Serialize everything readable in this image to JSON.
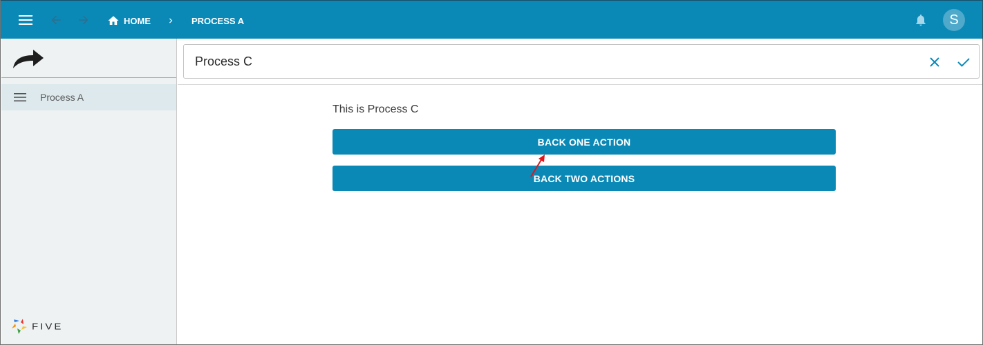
{
  "header": {
    "menu_icon": "hamburger-menu-icon",
    "back_icon": "arrow-back-icon",
    "forward_icon": "arrow-forward-icon",
    "breadcrumb": {
      "home_icon": "home-icon",
      "home_label": "HOME",
      "separator_icon": "chevron-right-icon",
      "current_label": "PROCESS A"
    },
    "notifications_icon": "bell-icon",
    "avatar_initial": "S"
  },
  "sidebar": {
    "top_icon": "redo-arrow-icon",
    "items": [
      {
        "icon": "list-menu-icon",
        "label": "Process A",
        "selected": true
      }
    ],
    "logo_text": "FIVE"
  },
  "main": {
    "title": "Process C",
    "cancel_icon": "close-icon",
    "confirm_icon": "check-icon",
    "description": "This is Process C",
    "buttons": [
      {
        "label": "BACK ONE ACTION"
      },
      {
        "label": "BACK TWO ACTIONS"
      }
    ]
  },
  "colors": {
    "primary": "#0b89b6",
    "sidebar_bg": "#eef2f3",
    "selected_item_bg": "#dde9ed",
    "annotation_arrow": "#e0161b"
  }
}
